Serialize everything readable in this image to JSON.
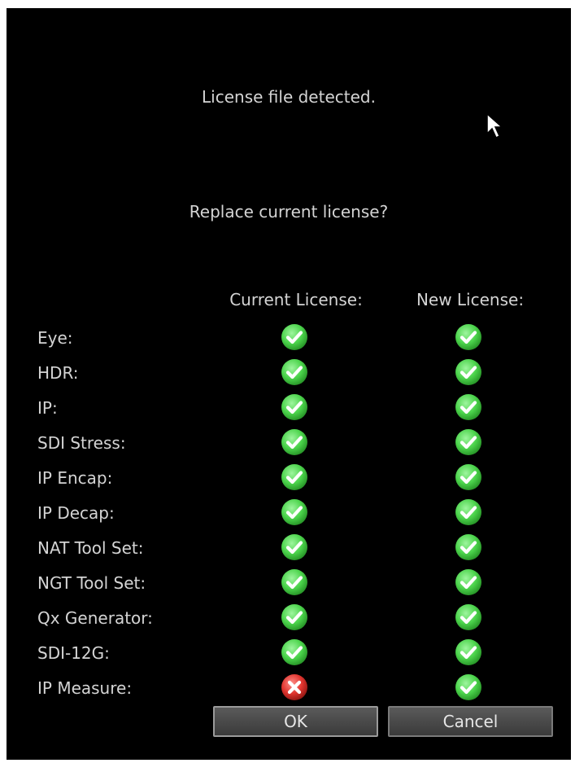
{
  "messages": {
    "detected": "License file detected.",
    "question": "Replace current license?"
  },
  "columns": {
    "current": "Current License:",
    "new": "New License:"
  },
  "features": [
    {
      "label": "Eye:",
      "current": "check",
      "new": "check"
    },
    {
      "label": "HDR:",
      "current": "check",
      "new": "check"
    },
    {
      "label": "IP:",
      "current": "check",
      "new": "check"
    },
    {
      "label": "SDI Stress:",
      "current": "check",
      "new": "check"
    },
    {
      "label": "IP Encap:",
      "current": "check",
      "new": "check"
    },
    {
      "label": "IP Decap:",
      "current": "check",
      "new": "check"
    },
    {
      "label": "NAT Tool Set:",
      "current": "check",
      "new": "check"
    },
    {
      "label": "NGT Tool Set:",
      "current": "check",
      "new": "check"
    },
    {
      "label": "Qx Generator:",
      "current": "check",
      "new": "check"
    },
    {
      "label": "SDI-12G:",
      "current": "check",
      "new": "check"
    },
    {
      "label": "IP Measure:",
      "current": "cross",
      "new": "check"
    }
  ],
  "buttons": {
    "ok": "OK",
    "cancel": "Cancel"
  },
  "colors": {
    "check": "#4cd44c",
    "cross": "#e0352f",
    "background": "#000000"
  }
}
